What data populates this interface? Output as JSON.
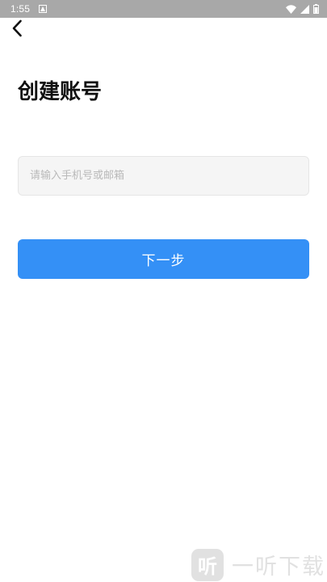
{
  "status_bar": {
    "time": "1:55"
  },
  "header": {
    "title": "创建账号"
  },
  "form": {
    "account_placeholder": "请输入手机号或邮箱",
    "account_value": ""
  },
  "actions": {
    "next_label": "下一步"
  },
  "watermark": {
    "logo_char": "听",
    "text": "一听下载"
  },
  "colors": {
    "primary": "#3490f6",
    "status_bar": "#a8a8a8",
    "input_bg": "#f5f5f5"
  },
  "icons": {
    "back": "chevron-left-icon",
    "wifi": "wifi-icon",
    "signal": "signal-icon",
    "battery": "battery-icon",
    "notification": "notification-icon"
  }
}
